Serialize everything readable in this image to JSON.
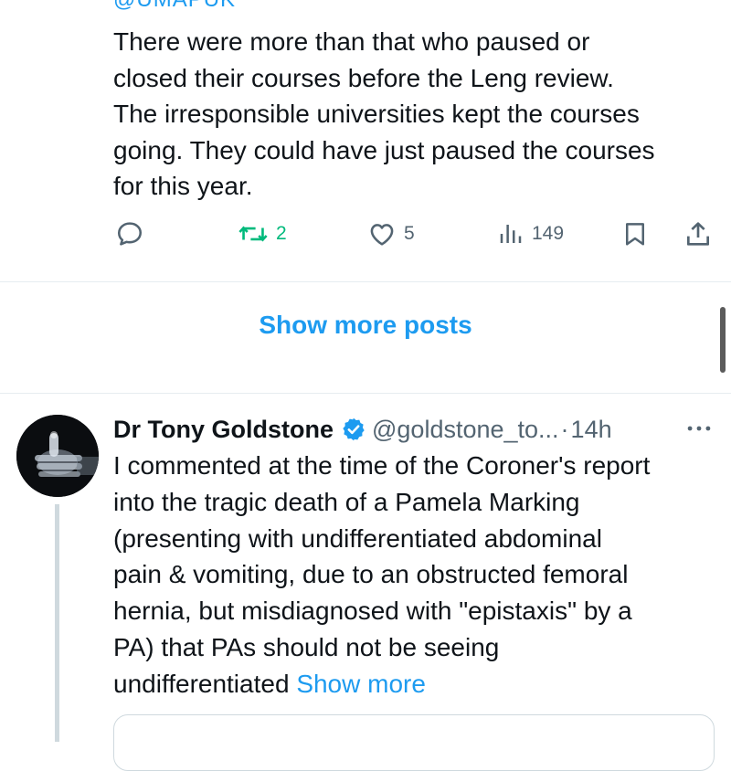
{
  "post1": {
    "handle_cut": "@UMAPUK",
    "text_lines": [
      "There were more than that who paused or",
      "closed their courses before the Leng review.",
      "The irresponsible universities kept the courses",
      "going.  They could have just paused the courses",
      "for this year."
    ],
    "actions": {
      "reply_icon": "reply-icon",
      "retweet_icon": "retweet-icon",
      "retweet_count": "2",
      "like_icon": "heart-icon",
      "like_count": "5",
      "views_icon": "views-bar-icon",
      "views_count": "149",
      "bookmark_icon": "bookmark-icon",
      "share_icon": "share-icon"
    }
  },
  "show_more_posts": "Show more posts",
  "post2": {
    "author_name": "Dr Tony Goldstone",
    "handle": "@goldstone_to...",
    "separator": "·",
    "time": "14h",
    "more_icon": "more-dots-icon",
    "text_lines": [
      "I commented at the time of the Coroner's report",
      "into the tragic death of a Pamela Marking",
      "(presenting with undifferentiated abdominal",
      "pain & vomiting, due to an obstructed femoral",
      "hernia, but misdiagnosed with \"epistaxis\" by a",
      "PA) that PAs should not be seeing"
    ],
    "last_line_text": "undifferentiated ",
    "show_more": "Show more"
  },
  "colors": {
    "accent": "#1d9bf0",
    "retweet_green": "#00ba7c",
    "muted": "#536471",
    "text": "#0f1419",
    "divider": "#e6ecf0"
  }
}
